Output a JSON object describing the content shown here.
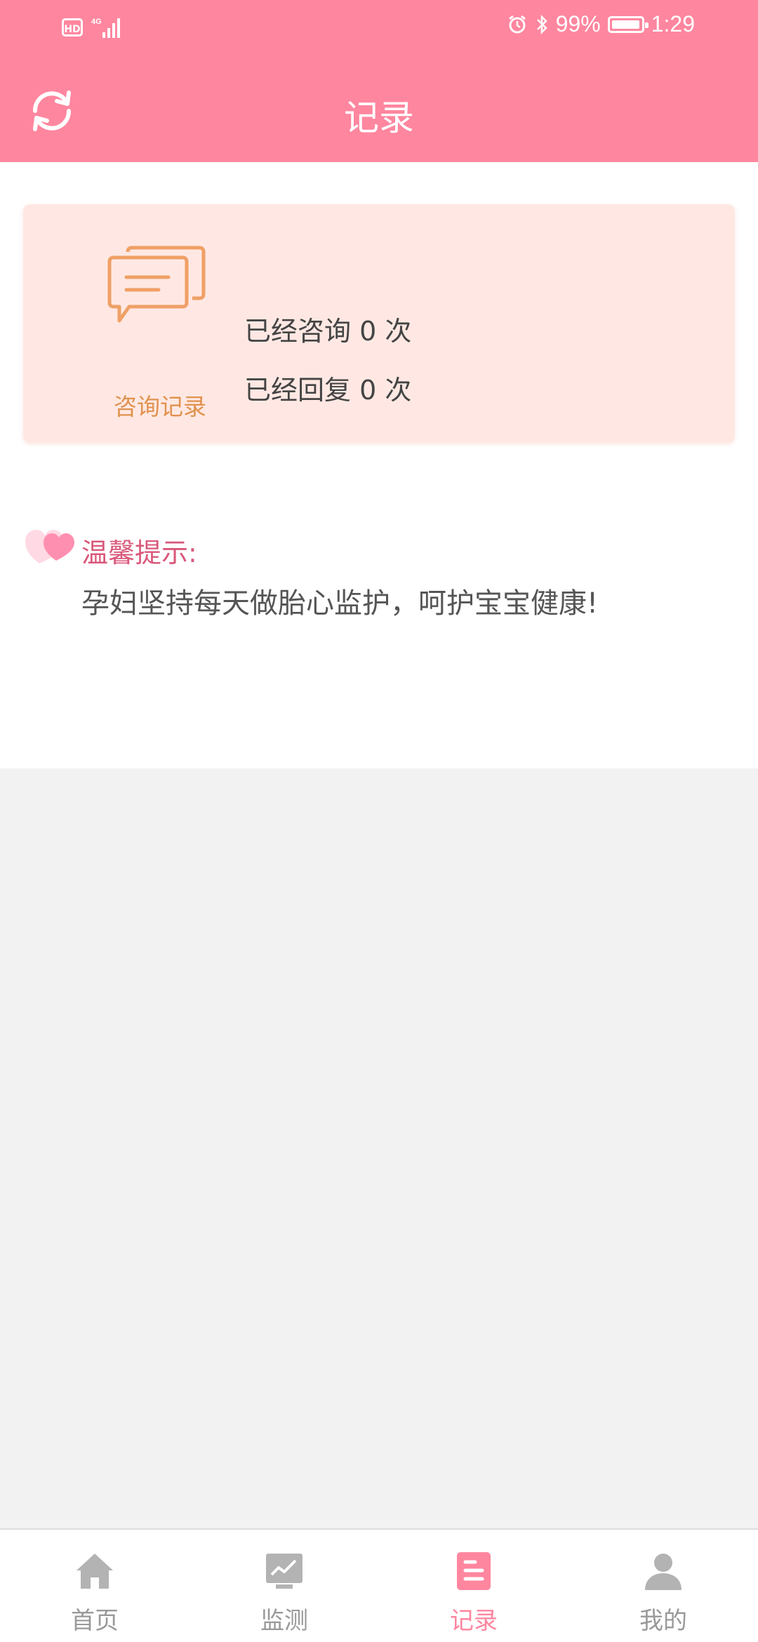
{
  "status_bar": {
    "hd": "HD",
    "network": "4G",
    "battery_percent": "99%",
    "battery_level": 0.99,
    "time": "1:29"
  },
  "header": {
    "title": "记录",
    "refresh_icon": "refresh-icon"
  },
  "consult_card": {
    "icon": "chat-bubbles-icon",
    "label": "咨询记录",
    "consulted_text": "已经咨询 0 次",
    "replied_text": "已经回复 0 次"
  },
  "tip": {
    "icon": "heart-icon",
    "title": "温馨提示:",
    "text": "孕妇坚持每天做胎心监护，呵护宝宝健康!"
  },
  "tabbar": {
    "items": [
      {
        "label": "首页",
        "icon": "home-icon"
      },
      {
        "label": "监测",
        "icon": "monitor-chart-icon"
      },
      {
        "label": "记录",
        "icon": "record-list-icon"
      },
      {
        "label": "我的",
        "icon": "user-icon"
      }
    ],
    "active_index": 2
  },
  "colors": {
    "header_bg": "#ff869f",
    "card_bg": "#ffe8e3",
    "consult_orange": "#e1924f",
    "tip_pink": "#d9587a",
    "tab_active": "#ff869f",
    "tab_inactive": "#999999"
  }
}
